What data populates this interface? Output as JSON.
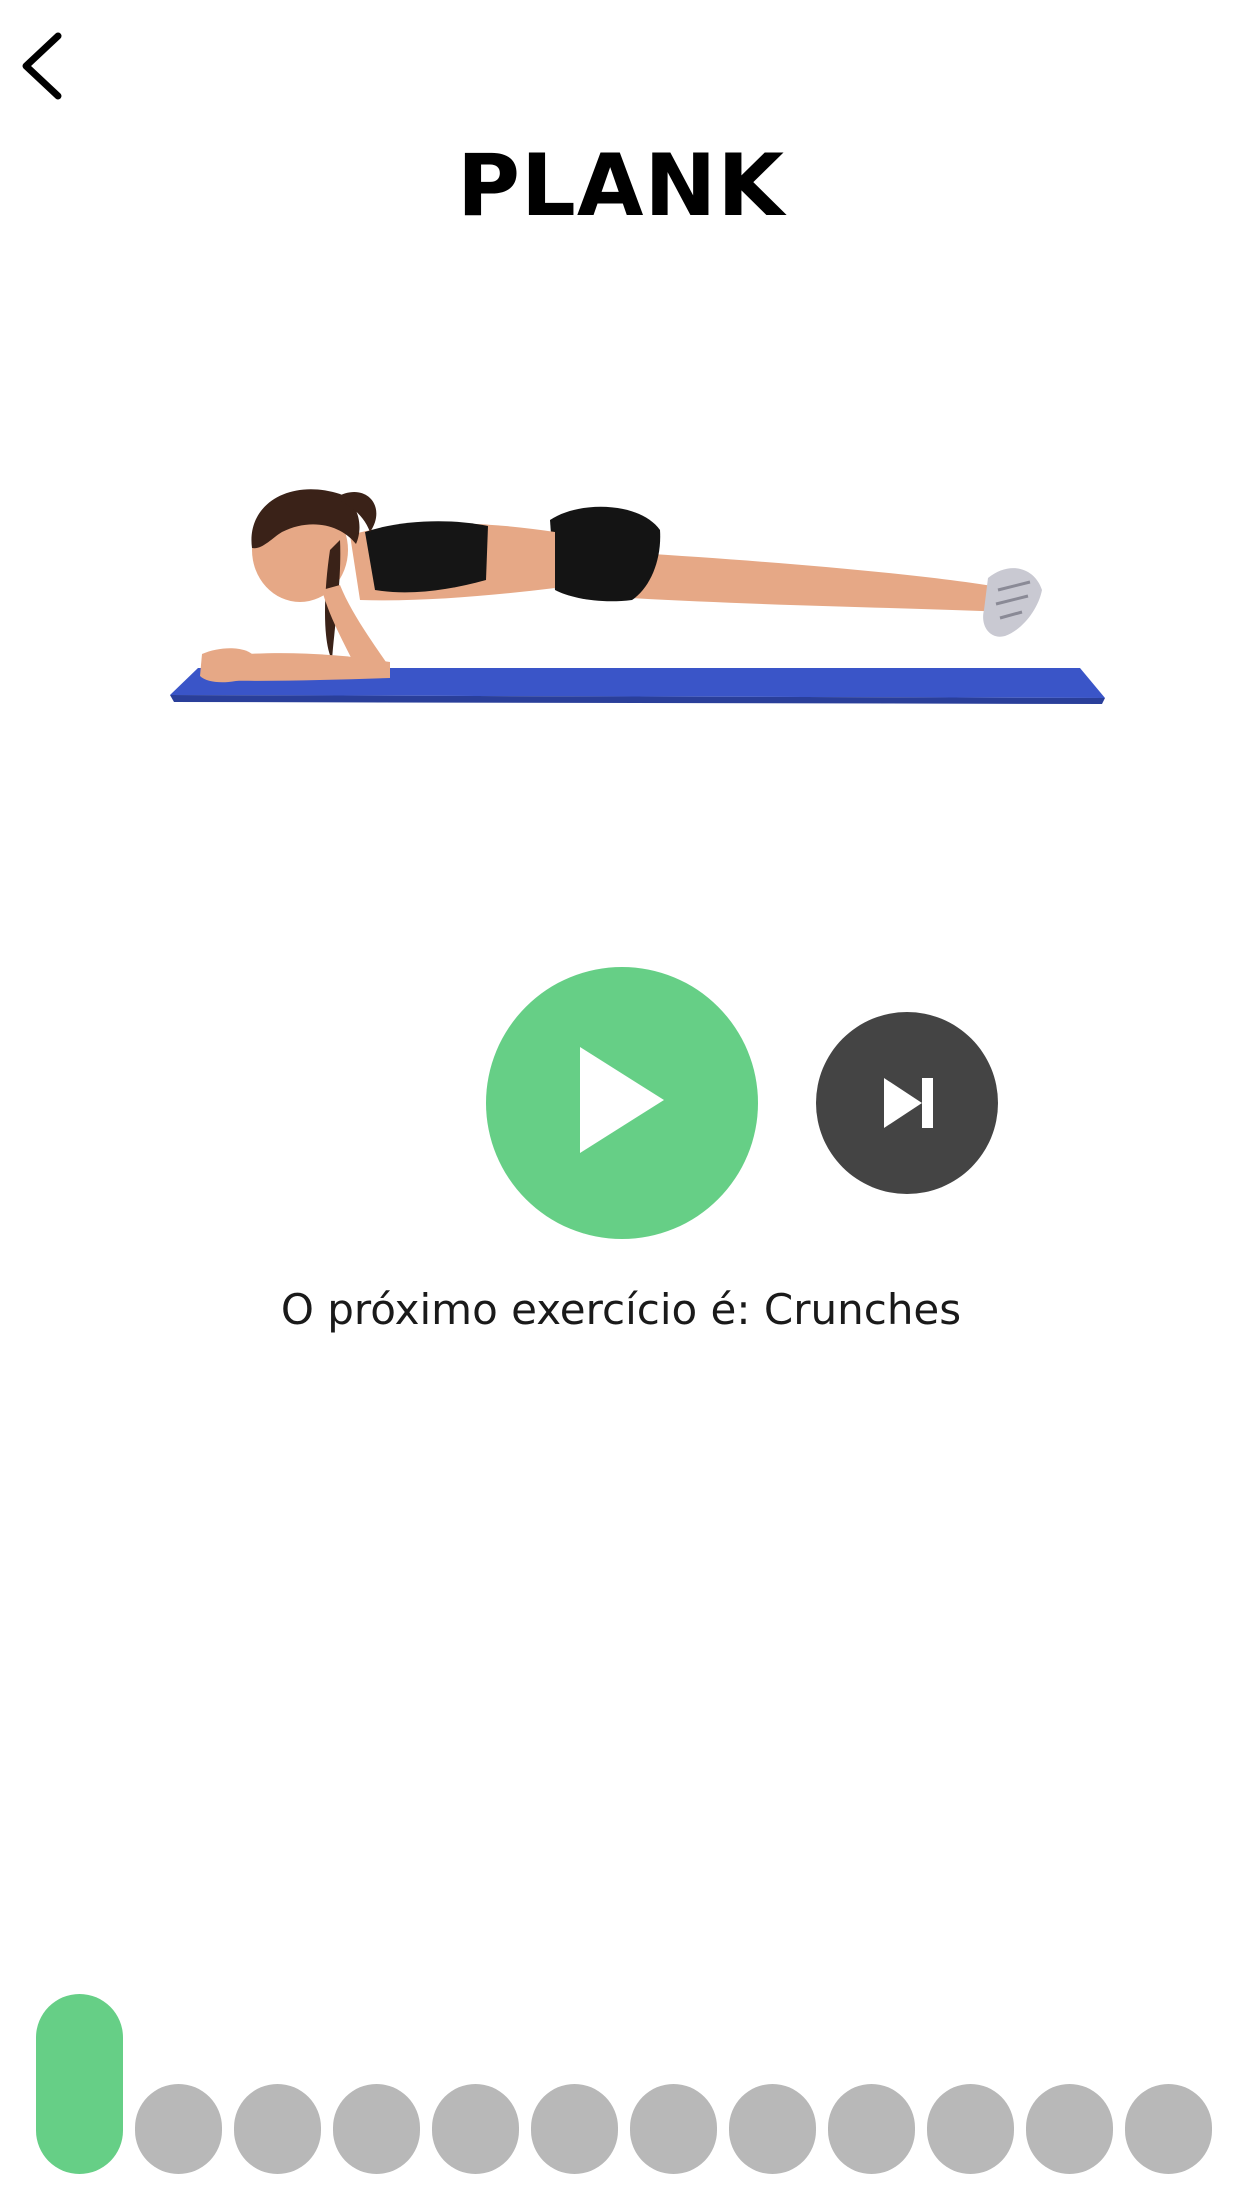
{
  "header": {
    "back_icon": "chevron-left-icon",
    "title": "PLANK"
  },
  "exercise": {
    "illustration": "plank-exercise-illustration",
    "mat_color": "#3a55c8"
  },
  "controls": {
    "play_icon": "play-icon",
    "skip_icon": "skip-next-icon",
    "play_color": "#66cf86",
    "skip_color": "#444444"
  },
  "next_exercise": {
    "text": "O próximo exercício é: Crunches"
  },
  "progress": {
    "total_steps": 12,
    "current_step": 1,
    "active_color": "#66cf86",
    "inactive_color": "#b8b8b8"
  }
}
